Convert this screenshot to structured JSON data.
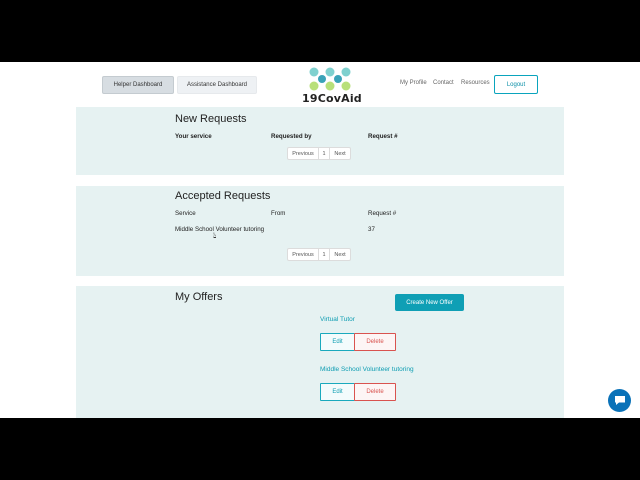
{
  "header": {
    "tabs": [
      "Helper Dashboard",
      "Assistance Dashboard"
    ],
    "logo_text": "19CovAid",
    "nav": [
      "My Profile",
      "Contact",
      "Resources"
    ],
    "logout_label": "Logout"
  },
  "new_requests": {
    "title": "New Requests",
    "columns": [
      "Your service",
      "Requested by",
      "Request #"
    ],
    "pager": {
      "previous": "Previous",
      "page": "1",
      "next": "Next"
    }
  },
  "accepted_requests": {
    "title": "Accepted Requests",
    "columns": [
      "Service",
      "From",
      "Request #"
    ],
    "rows": [
      {
        "service": "Middle School Volunteer tutoring",
        "from": "",
        "request": "37"
      }
    ],
    "pager": {
      "previous": "Previous",
      "page": "1",
      "next": "Next"
    }
  },
  "my_offers": {
    "title": "My Offers",
    "create_label": "Create New Offer",
    "offers": [
      {
        "title": "Virtual Tutor",
        "edit": "Edit",
        "delete": "Delete"
      },
      {
        "title": "Middle School Volunteer tutoring",
        "edit": "Edit",
        "delete": "Delete"
      }
    ]
  },
  "colors": {
    "accent": "#0f9fb5",
    "section_bg": "#e6f2f2",
    "danger": "#d9534f",
    "chat": "#0a72b8"
  },
  "icons": [
    "logo-icon",
    "chat-icon",
    "mouse-cursor-icon"
  ]
}
